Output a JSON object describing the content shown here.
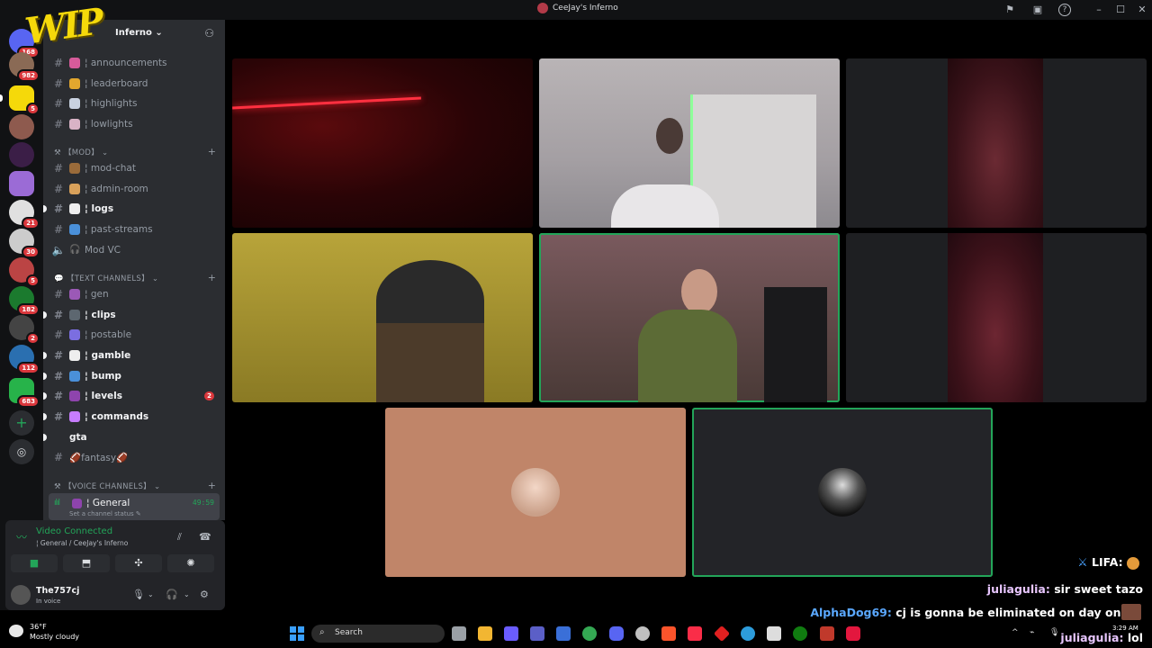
{
  "window": {
    "title": "CeeJay's Inferno"
  },
  "overlay_logo": "WIP",
  "server_rail": {
    "badges": [
      "168",
      "982",
      "5",
      "21",
      "30",
      "5",
      "182",
      "2",
      "112",
      "683"
    ]
  },
  "server": {
    "name": "Inferno",
    "name_chevron": "⌄"
  },
  "channels_top": [
    {
      "label": "¦ announcements"
    },
    {
      "label": "¦ leaderboard"
    },
    {
      "label": "¦ highlights"
    },
    {
      "label": "¦ lowlights"
    }
  ],
  "category_mod": "【MOD】",
  "channels_mod": [
    {
      "label": "¦ mod-chat"
    },
    {
      "label": "¦ admin-room"
    },
    {
      "label": "¦ logs"
    },
    {
      "label": "¦ past-streams"
    },
    {
      "label": "Mod VC"
    }
  ],
  "category_text": "【TEXT CHANNELS】",
  "channels_text": [
    {
      "label": "¦ gen"
    },
    {
      "label": "¦ clips"
    },
    {
      "label": "¦ postable"
    },
    {
      "label": "¦ gamble"
    },
    {
      "label": "¦ bump"
    },
    {
      "label": "¦ levels",
      "mentions": "2"
    },
    {
      "label": "¦ commands"
    },
    {
      "label": "gta"
    },
    {
      "label": "🏈fantasy🏈"
    }
  ],
  "category_voice": "【VOICE CHANNELS】",
  "voice_channel": {
    "name": "¦ General",
    "time": "49:59",
    "status": "Set a channel status ✎"
  },
  "voice_panel": {
    "status": "Video Connected",
    "sub": "¦ General / CeeJay's Inferno",
    "user": "The757cj",
    "user_status": "In voice"
  },
  "weather": {
    "temp": "36°F",
    "condition": "Mostly cloudy"
  },
  "taskbar": {
    "search_label": "Search"
  },
  "clock": {
    "time": "3:29 AM"
  },
  "chat": [
    {
      "user": "LIFA:",
      "message": ""
    },
    {
      "user": "juliagulia:",
      "message": "sir sweet tazo"
    },
    {
      "user": "AlphaDog69:",
      "message": "cj is gonna be eliminated on day one"
    },
    {
      "user": "juliagulia:",
      "message": "lol"
    }
  ],
  "colors": {
    "online_green": "#23a559",
    "mention_red": "#da373c",
    "sidebar_bg": "#2b2d31",
    "alpha_blue": "#5aa8ff",
    "julia_pink": "#e8c6ff"
  }
}
